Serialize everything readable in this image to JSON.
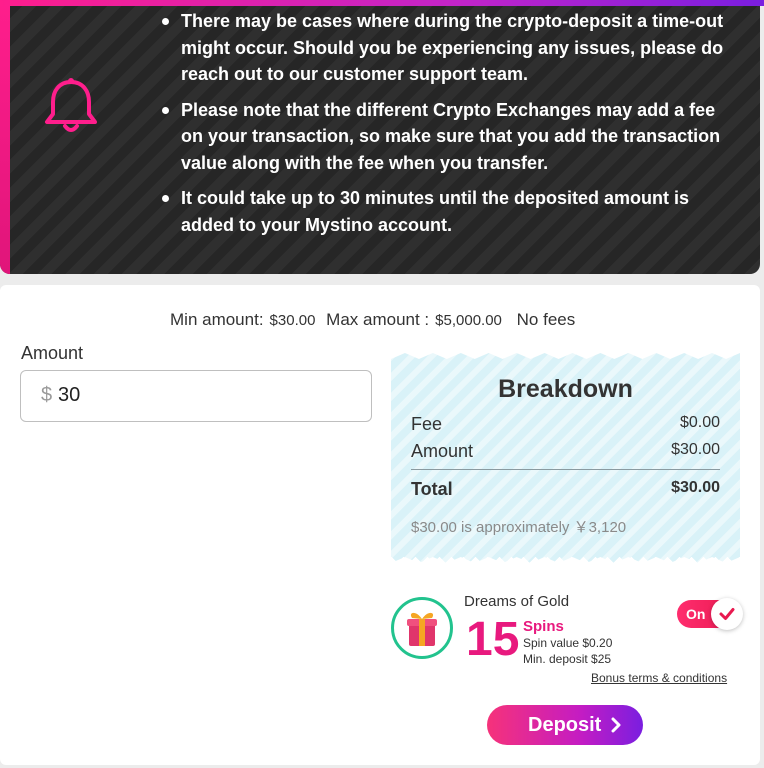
{
  "notice": {
    "items": [
      "There may be cases where during the crypto-deposit a time-out might occur. Should you be experiencing any issues, please do reach out to our customer support team.",
      "Please note that the different Crypto Exchanges may add a fee on your transaction, so make sure that you add the transaction value along with the fee when you transfer.",
      "It could take up to 30 minutes until the deposited amount is added to your Mystino account."
    ],
    "icon": "bell-icon"
  },
  "limits": {
    "min_label": "Min amount:",
    "min_value": "$30.00",
    "max_label": "Max amount :",
    "max_value": "$5,000.00",
    "fees": "No fees"
  },
  "amount": {
    "label": "Amount",
    "currency_symbol": "$",
    "value": "30"
  },
  "breakdown": {
    "title": "Breakdown",
    "fee_label": "Fee",
    "fee_value": "$0.00",
    "amount_label": "Amount",
    "amount_value": "$30.00",
    "total_label": "Total",
    "total_value": "$30.00",
    "approx_text": "$30.00 is approximately ￥3,120"
  },
  "promo": {
    "name": "Dreams of Gold",
    "spins_count": "15",
    "spins_label": "Spins",
    "spin_value": "Spin value $0.20",
    "min_deposit": "Min. deposit $25",
    "terms_link": "Bonus terms & conditions",
    "toggle_label": "On",
    "icon": "gift-icon"
  },
  "actions": {
    "deposit_label": "Deposit"
  },
  "colors": {
    "accent_pink": "#e8197e",
    "accent_purple": "#7a1ee0",
    "gift_ring": "#22c38e",
    "breakdown_bg": "#d9f2f8"
  }
}
